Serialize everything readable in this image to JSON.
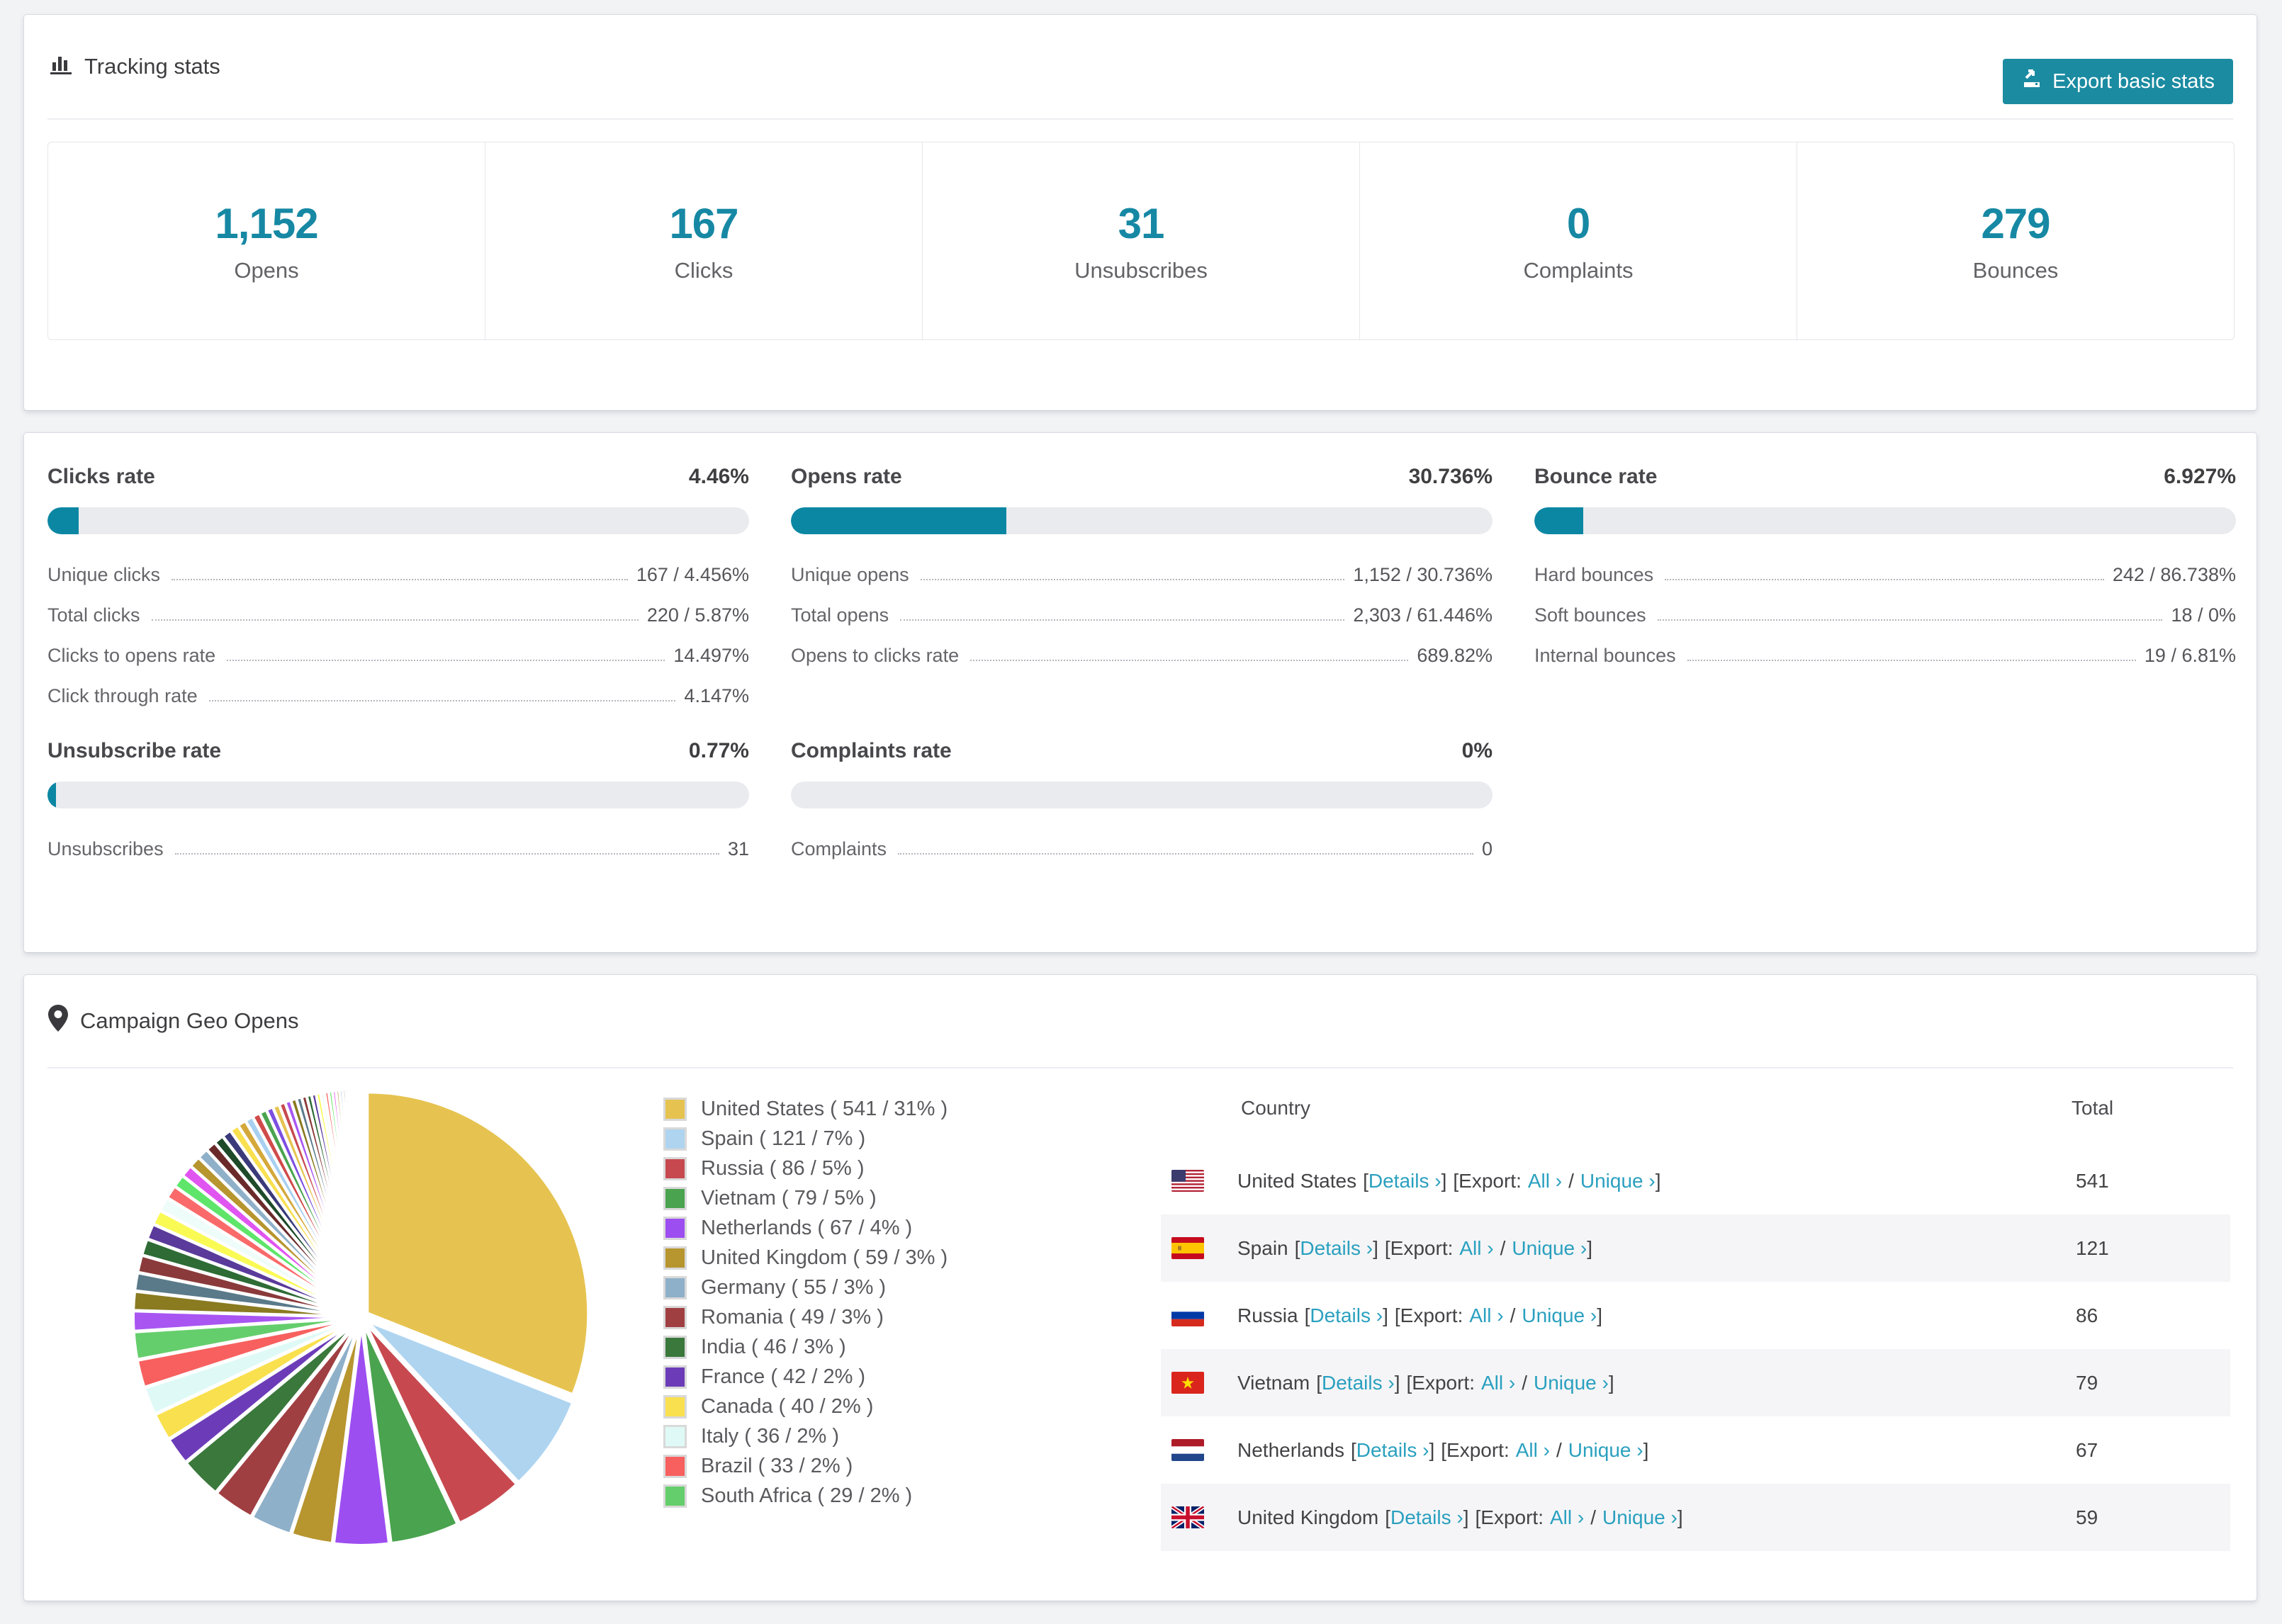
{
  "tracking": {
    "title": "Tracking stats",
    "export_button": "Export basic stats",
    "stats": [
      {
        "value": "1,152",
        "label": "Opens"
      },
      {
        "value": "167",
        "label": "Clicks"
      },
      {
        "value": "31",
        "label": "Unsubscribes"
      },
      {
        "value": "0",
        "label": "Complaints"
      },
      {
        "value": "279",
        "label": "Bounces"
      }
    ]
  },
  "rates": {
    "clicks": {
      "title": "Clicks rate",
      "value": "4.46%",
      "percent": 4.46,
      "rows": [
        {
          "label": "Unique clicks",
          "value": "167 / 4.456%"
        },
        {
          "label": "Total clicks",
          "value": "220 / 5.87%"
        },
        {
          "label": "Clicks to opens rate",
          "value": "14.497%"
        },
        {
          "label": "Click through rate",
          "value": "4.147%"
        }
      ]
    },
    "opens": {
      "title": "Opens rate",
      "value": "30.736%",
      "percent": 30.736,
      "rows": [
        {
          "label": "Unique opens",
          "value": "1,152 / 30.736%"
        },
        {
          "label": "Total opens",
          "value": "2,303 / 61.446%"
        },
        {
          "label": "Opens to clicks rate",
          "value": "689.82%"
        }
      ]
    },
    "bounce": {
      "title": "Bounce rate",
      "value": "6.927%",
      "percent": 6.927,
      "rows": [
        {
          "label": "Hard bounces",
          "value": "242 / 86.738%"
        },
        {
          "label": "Soft bounces",
          "value": "18 / 0%"
        },
        {
          "label": "Internal bounces",
          "value": "19 / 6.81%"
        }
      ]
    },
    "unsubscribe": {
      "title": "Unsubscribe rate",
      "value": "0.77%",
      "percent": 0.77,
      "rows": [
        {
          "label": "Unsubscribes",
          "value": "31"
        }
      ]
    },
    "complaints": {
      "title": "Complaints rate",
      "value": "0%",
      "percent": 0,
      "rows": [
        {
          "label": "Complaints",
          "value": "0"
        }
      ]
    }
  },
  "geo": {
    "title": "Campaign Geo Opens",
    "table": {
      "header": {
        "country": "Country",
        "total": "Total"
      },
      "labels": {
        "details": "Details ›",
        "export_prefix": "[Export:",
        "all": "All ›",
        "slash": "/",
        "unique": "Unique ›",
        "open": "[",
        "close": "]"
      },
      "rows": [
        {
          "name": "United States",
          "total": "541"
        },
        {
          "name": "Spain",
          "total": "121"
        },
        {
          "name": "Russia",
          "total": "86"
        },
        {
          "name": "Vietnam",
          "total": "79"
        },
        {
          "name": "Netherlands",
          "total": "67"
        },
        {
          "name": "United Kingdom",
          "total": "59"
        },
        {
          "name": "",
          "total": ""
        }
      ]
    }
  },
  "chart_data": {
    "type": "pie",
    "title": "Campaign Geo Opens",
    "legend_position": "right",
    "start_angle_deg": -90,
    "direction": "clockwise",
    "series": [
      {
        "label": "United States ( 541 / 31% )",
        "name": "United States",
        "value": 541,
        "percent": 31,
        "color": "#e6c350"
      },
      {
        "label": "Spain ( 121 / 7% )",
        "name": "Spain",
        "value": 121,
        "percent": 7,
        "color": "#aed4f0"
      },
      {
        "label": "Russia ( 86 / 5% )",
        "name": "Russia",
        "value": 86,
        "percent": 5,
        "color": "#c7494f"
      },
      {
        "label": "Vietnam ( 79 / 5% )",
        "name": "Vietnam",
        "value": 79,
        "percent": 5,
        "color": "#4aa34f"
      },
      {
        "label": "Netherlands ( 67 / 4% )",
        "name": "Netherlands",
        "value": 67,
        "percent": 4,
        "color": "#9d4ef0"
      },
      {
        "label": "United Kingdom ( 59 / 3% )",
        "name": "United Kingdom",
        "value": 59,
        "percent": 3,
        "color": "#b7952f"
      },
      {
        "label": "Germany ( 55 / 3% )",
        "name": "Germany",
        "value": 55,
        "percent": 3,
        "color": "#8fb0c9"
      },
      {
        "label": "Romania ( 49 / 3% )",
        "name": "Romania",
        "value": 49,
        "percent": 3,
        "color": "#a03f42"
      },
      {
        "label": "India ( 46 / 3% )",
        "name": "India",
        "value": 46,
        "percent": 3,
        "color": "#3a783c"
      },
      {
        "label": "France ( 42 / 2% )",
        "name": "France",
        "value": 42,
        "percent": 2,
        "color": "#6c3cb8"
      },
      {
        "label": "Canada ( 40 / 2% )",
        "name": "Canada",
        "value": 40,
        "percent": 2,
        "color": "#f9e04e"
      },
      {
        "label": "Italy ( 36 / 2% )",
        "name": "Italy",
        "value": 36,
        "percent": 2,
        "color": "#dffaf6"
      },
      {
        "label": "Brazil ( 33 / 2% )",
        "name": "Brazil",
        "value": 33,
        "percent": 2,
        "color": "#f7605f"
      },
      {
        "label": "South Africa ( 29 / 2% )",
        "name": "South Africa",
        "value": 29,
        "percent": 2,
        "color": "#65ce6c"
      }
    ],
    "others_tail": {
      "count": 44,
      "total_percent": 26,
      "first": 1.45,
      "decay": 0.95,
      "palette": [
        "#a855f2",
        "#8a7a20",
        "#5a7a8a",
        "#8a3a3a",
        "#2e6b35",
        "#5a3a9a",
        "#fafa55",
        "#eefcfa",
        "#fa6a6a",
        "#5ee56a",
        "#e055f0",
        "#b7952f",
        "#8fb0c9",
        "#6a2a2a",
        "#1e4a2a",
        "#3a3a7a",
        "#f9e04e",
        "#d4a83a",
        "#a8d0f0",
        "#d04a4a",
        "#4aa34f",
        "#7c4fe0",
        "#e6c350",
        "#c7494f"
      ]
    }
  }
}
